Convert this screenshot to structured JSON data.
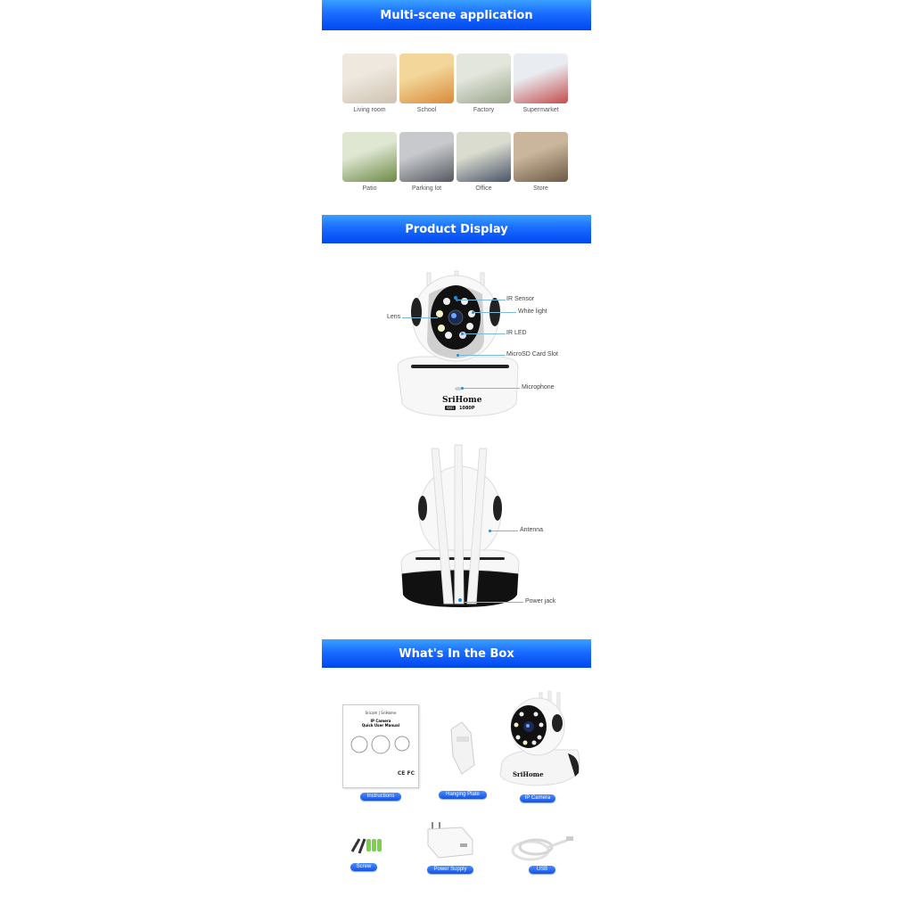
{
  "sections": {
    "multi_scene": {
      "title": "Multi-scene application"
    },
    "product_display": {
      "title": "Product Display"
    },
    "in_box": {
      "title": "What's In the Box"
    }
  },
  "scenes": [
    {
      "label": "Living room",
      "colors": [
        "#eee8df",
        "#cfc3b1"
      ]
    },
    {
      "label": "School",
      "colors": [
        "#f3d79a",
        "#d98b3c"
      ]
    },
    {
      "label": "Factory",
      "colors": [
        "#e3e6dd",
        "#9aa68c"
      ]
    },
    {
      "label": "Supermarket",
      "colors": [
        "#e9edf2",
        "#c44d4d"
      ]
    },
    {
      "label": "Patio",
      "colors": [
        "#dfe6d2",
        "#6b8a45"
      ]
    },
    {
      "label": "Parking lot",
      "colors": [
        "#c7c9cd",
        "#55595f"
      ]
    },
    {
      "label": "Office",
      "colors": [
        "#d9dccf",
        "#4a5468"
      ]
    },
    {
      "label": "Store",
      "colors": [
        "#c9b69c",
        "#6d5a44"
      ]
    }
  ],
  "front_callouts": {
    "lens": "Lens",
    "ir_sensor": "IR Sensor",
    "white_light": "White light",
    "ir_led": "IR LED",
    "sd_slot": "MicroSD Card Slot",
    "microphone": "Microphone"
  },
  "back_callouts": {
    "antenna": "Antenna",
    "power_jack": "Power jack"
  },
  "brand": {
    "name": "SriHome",
    "badge": "1080P",
    "wifi": "WiFi"
  },
  "manual": {
    "brand_line": "Sricam | SriHome",
    "title_1": "IP Camera",
    "title_2": "Quick User Manual",
    "marks": "CE FC"
  },
  "box_items": [
    {
      "label": "Instructions"
    },
    {
      "label": "Hanging Plate"
    },
    {
      "label": "IP Camera"
    },
    {
      "label": "Screw"
    },
    {
      "label": "Power Supply"
    },
    {
      "label": "USB"
    }
  ]
}
